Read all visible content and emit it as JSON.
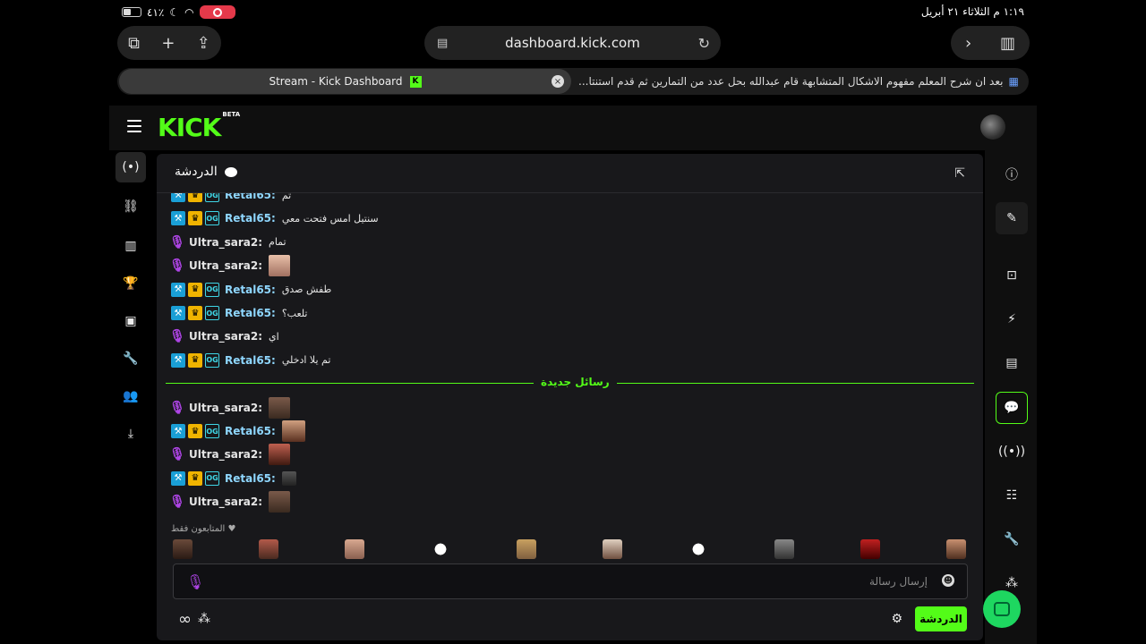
{
  "statusbar": {
    "battery": "٤١٪",
    "time_date": "١:١٩ م   الثلاثاء ٢١ أبريل"
  },
  "browser": {
    "url": "dashboard.kick.com",
    "active_tab": "Stream - Kick Dashboard",
    "other_tab": "بعد ان شرح المعلم مفهوم الاشكال المتشابهة قام عبدالله بحل عدد من التمارين ثم قدم استنتا..."
  },
  "kick": {
    "logo": "KICK",
    "logo_beta": "BETA"
  },
  "chat": {
    "title": "الدردشة",
    "new_messages_label": "رسائل جديدة",
    "followers_only_label": "المتابعون فقط",
    "input_placeholder": "إرسال رسالة",
    "send_button": "الدردشة",
    "messages_before": [
      {
        "user": "Retal65:",
        "text": "تم",
        "badges": "retal"
      },
      {
        "user": "Retal65:",
        "text": "سنتيل امس فتحت معي",
        "badges": "retal"
      },
      {
        "user": "Ultra_sara2:",
        "text": "تمام",
        "badges": "ultra"
      },
      {
        "user": "Ultra_sara2:",
        "text": "",
        "badges": "ultra",
        "emote": "baby"
      },
      {
        "user": "Retal65:",
        "text": "طفش صدق",
        "badges": "retal"
      },
      {
        "user": "Retal65:",
        "text": "تلعب؟",
        "badges": "retal"
      },
      {
        "user": "Ultra_sara2:",
        "text": "اي",
        "badges": "ultra"
      },
      {
        "user": "Retal65:",
        "text": "تم يلا ادخلي",
        "badges": "retal"
      }
    ],
    "messages_after": [
      {
        "user": "Ultra_sara2:",
        "text": "",
        "badges": "ultra",
        "emote": "face"
      },
      {
        "user": "Retal65:",
        "text": "",
        "badges": "retal",
        "emote": "wide"
      },
      {
        "user": "Ultra_sara2:",
        "text": "",
        "badges": "ultra",
        "emote": "mouth"
      },
      {
        "user": "Retal65:",
        "text": "",
        "badges": "retal",
        "emote": "small"
      },
      {
        "user": "Ultra_sara2:",
        "text": "",
        "badges": "ultra",
        "emote": "face"
      }
    ]
  },
  "colors": {
    "kick_green": "#53fc18",
    "panel": "#18181b",
    "mod_badge": "#1a9fd6",
    "crown_badge": "#f0b400",
    "mic_purple": "#b045e8"
  }
}
